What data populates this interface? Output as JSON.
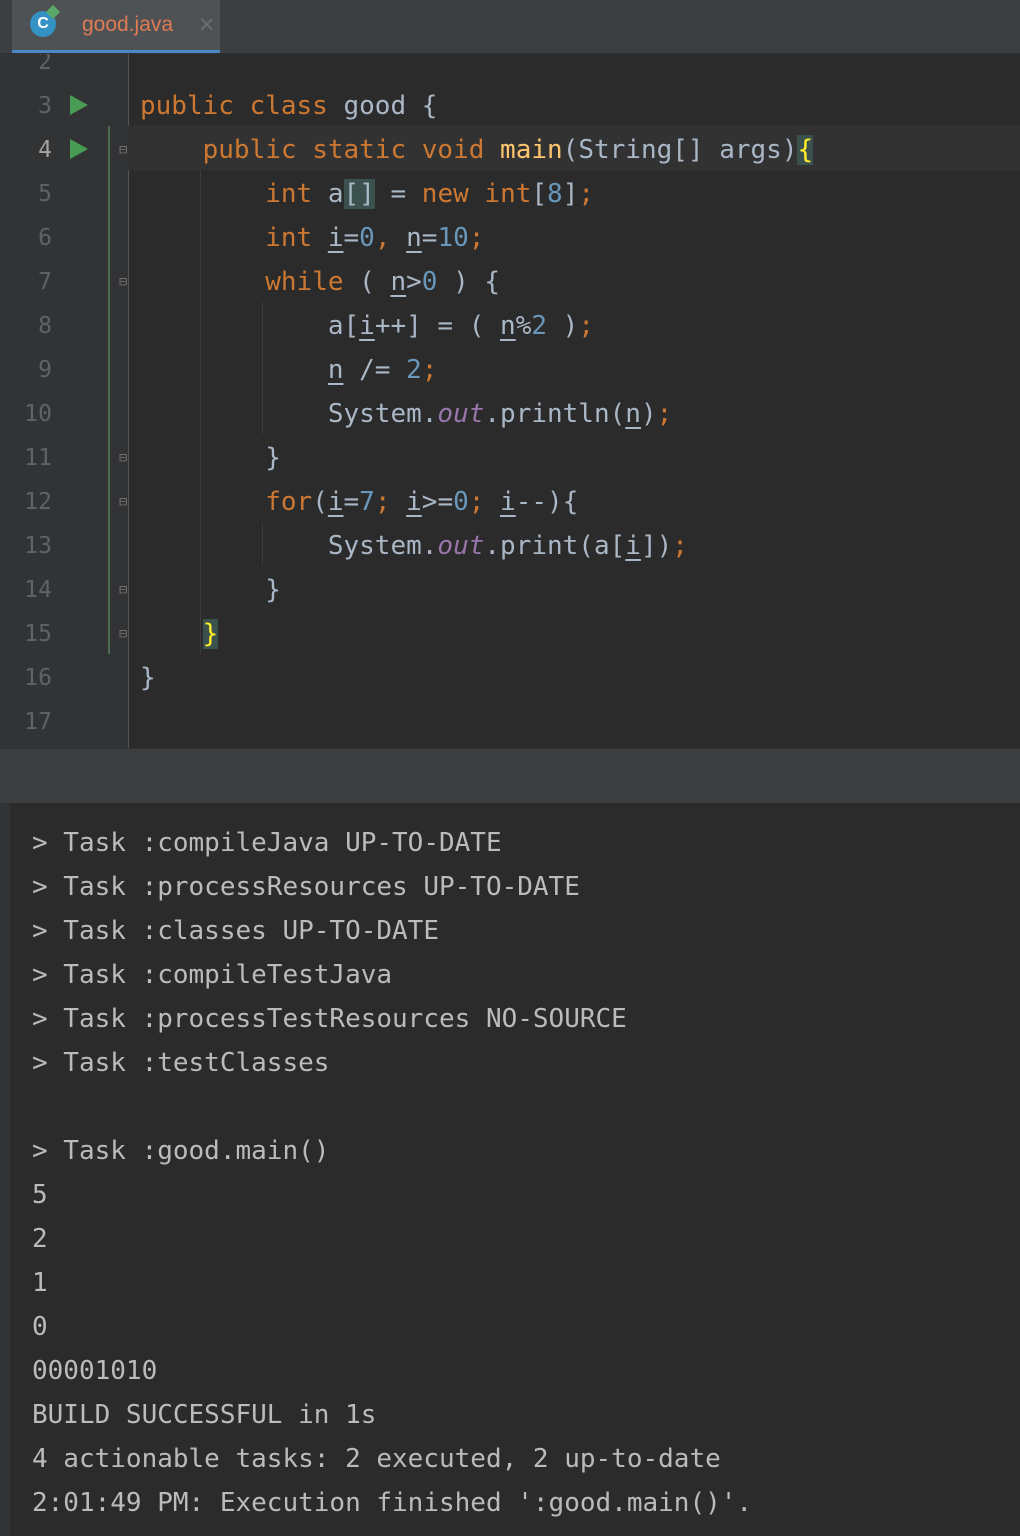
{
  "tab": {
    "title": "good.java",
    "icon_letter": "C",
    "close_glyph": "×"
  },
  "editor": {
    "line_numbers": [
      "2",
      "3",
      "4",
      "5",
      "6",
      "7",
      "8",
      "9",
      "10",
      "11",
      "12",
      "13",
      "14",
      "15",
      "16",
      "17"
    ],
    "current_line": "4",
    "run_lines": [
      "3",
      "4"
    ]
  },
  "console": {
    "lines": [
      "> Task :compileJava UP-TO-DATE",
      "> Task :processResources UP-TO-DATE",
      "> Task :classes UP-TO-DATE",
      "> Task :compileTestJava",
      "> Task :processTestResources NO-SOURCE",
      "> Task :testClasses",
      "",
      "> Task :good.main()",
      "5",
      "2",
      "1",
      "0",
      "00001010",
      "BUILD SUCCESSFUL in 1s",
      "4 actionable tasks: 2 executed, 2 up-to-date",
      "2:01:49 PM: Execution finished ':good.main()'."
    ]
  },
  "colors": {
    "keyword": "#cc7832",
    "method": "#ffc66d",
    "number": "#6897bb",
    "static_field": "#9876aa",
    "text": "#a9b7c6",
    "tab_title": "#e07b54",
    "run_icon": "#499c54"
  },
  "icons": {
    "tab": "java-class-icon",
    "run": "run-gutter-icon",
    "fold": "fold-marker-icon",
    "close": "close-icon"
  }
}
